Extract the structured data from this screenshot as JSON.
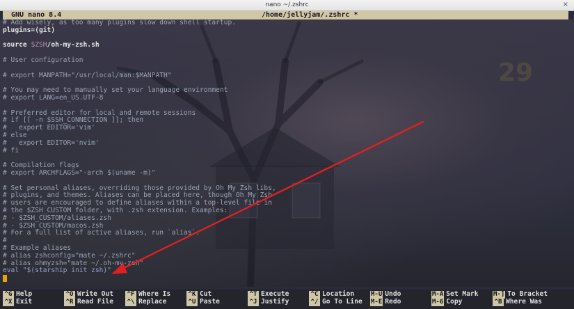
{
  "window": {
    "title": "nano ~/.zshrc",
    "close_glyph": "×"
  },
  "nano": {
    "version": "GNU nano 8.4",
    "filename": "/home/jellyjam/.zshrc *"
  },
  "editor": {
    "lines": [
      {
        "text": "# Add wisely, as too many plugins slow down shell startup.",
        "type": "comment"
      },
      {
        "parts": [
          {
            "t": "plugins=(",
            "c": "key"
          },
          {
            "t": "git",
            "c": "key"
          },
          {
            "t": ")",
            "c": "key"
          }
        ]
      },
      {
        "text": "",
        "type": "plain"
      },
      {
        "parts": [
          {
            "t": "source ",
            "c": "key"
          },
          {
            "t": "$ZSH",
            "c": "mag"
          },
          {
            "t": "/oh-my-zsh.sh",
            "c": "key"
          }
        ]
      },
      {
        "text": "",
        "type": "plain"
      },
      {
        "text": "# User configuration",
        "type": "comment"
      },
      {
        "text": "",
        "type": "plain"
      },
      {
        "text": "# export MANPATH=\"/usr/local/man:$MANPATH\"",
        "type": "comment"
      },
      {
        "text": "",
        "type": "plain"
      },
      {
        "text": "# You may need to manually set your language environment",
        "type": "comment"
      },
      {
        "text": "# export LANG=en_US.UTF-8",
        "type": "comment"
      },
      {
        "text": "",
        "type": "plain"
      },
      {
        "text": "# Preferred editor for local and remote sessions",
        "type": "comment"
      },
      {
        "text": "# if [[ -n $SSH_CONNECTION ]]; then",
        "type": "comment"
      },
      {
        "text": "#   export EDITOR='vim'",
        "type": "comment"
      },
      {
        "text": "# else",
        "type": "comment"
      },
      {
        "text": "#   export EDITOR='nvim'",
        "type": "comment"
      },
      {
        "text": "# fi",
        "type": "comment"
      },
      {
        "text": "",
        "type": "plain"
      },
      {
        "text": "# Compilation flags",
        "type": "comment"
      },
      {
        "text": "# export ARCHFLAGS=\"-arch $(uname -m)\"",
        "type": "comment"
      },
      {
        "text": "",
        "type": "plain"
      },
      {
        "text": "# Set personal aliases, overriding those provided by Oh My Zsh libs,",
        "type": "comment"
      },
      {
        "text": "# plugins, and themes. Aliases can be placed here, though Oh My Zsh",
        "type": "comment"
      },
      {
        "text": "# users are encouraged to define aliases within a top-level file in",
        "type": "comment"
      },
      {
        "text": "# the $ZSH_CUSTOM folder, with .zsh extension. Examples:",
        "type": "comment"
      },
      {
        "text": "# - $ZSH_CUSTOM/aliases.zsh",
        "type": "comment"
      },
      {
        "text": "# - $ZSH_CUSTOM/macos.zsh",
        "type": "comment"
      },
      {
        "text": "# For a full list of active aliases, run `alias`.",
        "type": "comment"
      },
      {
        "text": "#",
        "type": "comment"
      },
      {
        "text": "# Example aliases",
        "type": "comment"
      },
      {
        "text": "# alias zshconfig=\"mate ~/.zshrc\"",
        "type": "comment"
      },
      {
        "text": "# alias ohmyzsh=\"mate ~/.oh-my-zsh\"",
        "type": "comment"
      },
      {
        "text": "eval \"$(starship init zsh)\"",
        "type": "eval"
      },
      {
        "text": "",
        "type": "cursor"
      }
    ]
  },
  "shortcuts": [
    {
      "key": "^G",
      "label": "Help"
    },
    {
      "key": "^X",
      "label": "Exit"
    },
    {
      "key": "^O",
      "label": "Write Out"
    },
    {
      "key": "^R",
      "label": "Read File"
    },
    {
      "key": "^F",
      "label": "Where Is"
    },
    {
      "key": "^\\",
      "label": "Replace"
    },
    {
      "key": "^K",
      "label": "Cut"
    },
    {
      "key": "^U",
      "label": "Paste"
    },
    {
      "key": "^T",
      "label": "Execute"
    },
    {
      "key": "^J",
      "label": "Justify"
    },
    {
      "key": "^C",
      "label": "Location"
    },
    {
      "key": "^/",
      "label": "Go To Line"
    },
    {
      "key": "M-U",
      "label": "Undo"
    },
    {
      "key": "M-E",
      "label": "Redo"
    },
    {
      "key": "M-A",
      "label": "Set Mark"
    },
    {
      "key": "M-6",
      "label": "Copy"
    },
    {
      "key": "M-]",
      "label": "To Bracket"
    },
    {
      "key": "^B",
      "label": "Where Was"
    }
  ],
  "colors": {
    "header_bar": "#cfc7a6",
    "cursor": "#e9a500",
    "arrow": "#e02020",
    "background": "#2a2b3a"
  }
}
